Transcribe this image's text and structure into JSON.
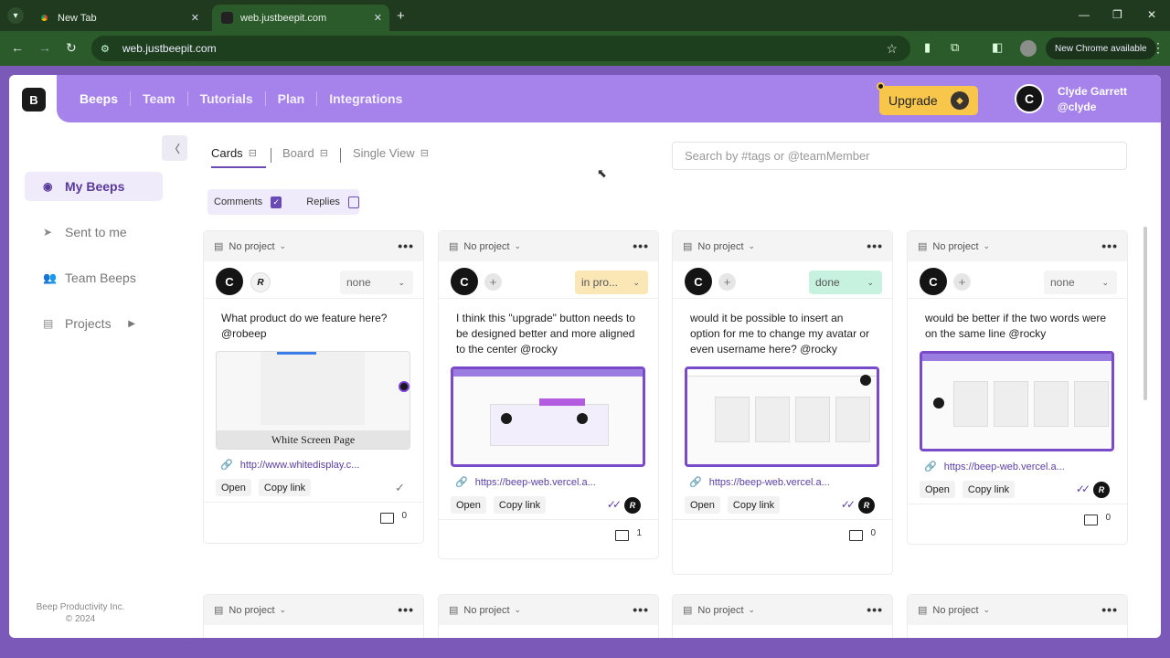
{
  "browser": {
    "tabs": [
      {
        "title": "New Tab"
      },
      {
        "title": "web.justbeepit.com"
      }
    ],
    "url": "web.justbeepit.com",
    "chrome_banner": "New Chrome available"
  },
  "nav": {
    "links": [
      "Beeps",
      "Team",
      "Tutorials",
      "Plan",
      "Integrations"
    ],
    "upgrade_label": "Upgrade",
    "user_name": "Clyde Garrett",
    "user_handle": "@clyde",
    "avatar_initial": "C"
  },
  "sidebar": {
    "items": [
      {
        "label": "My Beeps",
        "icon": "user-circle-icon"
      },
      {
        "label": "Sent to me",
        "icon": "send-icon"
      },
      {
        "label": "Team Beeps",
        "icon": "team-icon"
      },
      {
        "label": "Projects",
        "icon": "stack-icon"
      }
    ],
    "footer_company": "Beep Productivity Inc.",
    "footer_year": "© 2024"
  },
  "views": {
    "tabs": [
      "Cards",
      "Board",
      "Single View"
    ],
    "search_placeholder": "Search by #tags or @teamMember"
  },
  "filters": {
    "comments_label": "Comments",
    "comments_checked": true,
    "replies_label": "Replies",
    "replies_checked": false
  },
  "cards": [
    {
      "project": "No project",
      "status": "none",
      "text": "What product do we feature here? @robeep",
      "screenshot_caption": "White Screen Page",
      "link": "http://www.whitedisplay.c...",
      "open_label": "Open",
      "copy_label": "Copy link",
      "comment_count": "0"
    },
    {
      "project": "No project",
      "status": "in pro...",
      "text": "I think this \"upgrade\" button needs to be designed better and more aligned to the center @rocky",
      "link": "https://beep-web.vercel.a...",
      "open_label": "Open",
      "copy_label": "Copy link",
      "comment_count": "1"
    },
    {
      "project": "No project",
      "status": "done",
      "text": "would it be possible to insert an option for me to change my avatar or even username here? @rocky",
      "link": "https://beep-web.vercel.a...",
      "open_label": "Open",
      "copy_label": "Copy link",
      "comment_count": "0"
    },
    {
      "project": "No project",
      "status": "none",
      "text": "would be better if the two words were on the same line @rocky",
      "link": "https://beep-web.vercel.a...",
      "open_label": "Open",
      "copy_label": "Copy link",
      "comment_count": "0"
    }
  ],
  "second_row_projects": [
    "No project",
    "No project",
    "No project",
    "No project"
  ],
  "colors": {
    "accent": "#a583ea",
    "upgrade": "#f8c64a",
    "in_progress": "#fbe6b5",
    "done": "#c6f2df"
  }
}
